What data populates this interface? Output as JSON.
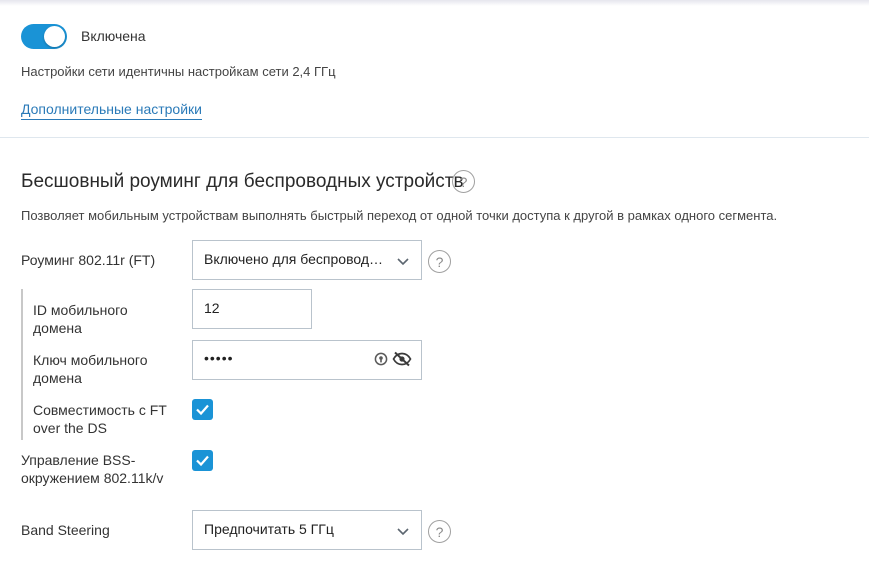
{
  "toggle": {
    "state": "on",
    "label": "Включена"
  },
  "note": "Настройки сети идентичны настройкам сети 2,4 ГГц",
  "advanced_link": "Дополнительные настройки",
  "roaming_section": {
    "title": "Бесшовный роуминг для беспроводных устройств",
    "help": "?",
    "description": "Позволяет мобильным устройствам выполнять быстрый переход от одной точки доступа к другой в рамках одного сегмента.",
    "ft": {
      "label": "Роуминг 802.11r (FT)",
      "value": "Включено для беспроводн...",
      "help": "?"
    },
    "mobility_domain_id": {
      "label_line1": "ID мобильного",
      "label_line2": "домена",
      "value": "12"
    },
    "mobility_domain_key": {
      "label_line1": "Ключ мобильного",
      "label_line2": "домена",
      "value": "•••••"
    },
    "ft_over_ds": {
      "label_line1": "Совместимость с FT",
      "label_line2": "over the DS",
      "checked": true
    },
    "bss_transition": {
      "label_line1": "Управление BSS-",
      "label_line2": "окружением 802.11k/v",
      "checked": true
    },
    "band_steering": {
      "label": "Band Steering",
      "value": "Предпочитать 5 ГГц",
      "help": "?"
    }
  },
  "colors": {
    "accent": "#1a93d6",
    "link": "#2a7ab8",
    "border": "#b9c3cc"
  }
}
